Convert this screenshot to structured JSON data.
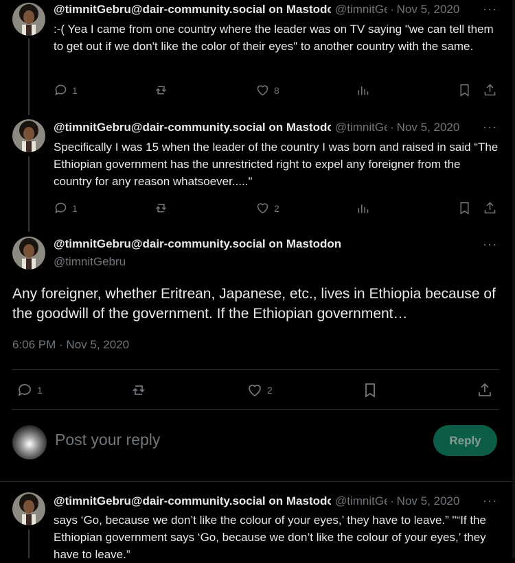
{
  "tweets_above": [
    {
      "name": "@timnitGebru@dair-community.social on Mastodon",
      "handle": "@timnitGebru",
      "date": "Nov 5, 2020",
      "text": ":-( Yea I came from one country where the leader was on TV saying \"we can tell them to get out if we don't like the color of their eyes\" to another country with the same.",
      "replies": "1",
      "likes": "8"
    },
    {
      "name": "@timnitGebru@dair-community.social on Mastodon",
      "handle": "@timnitGebru",
      "date": "Nov 5, 2020",
      "text": "Specifically I was 15 when the leader of the country I was born and raised in said “The Ethiopian government has the unrestricted right to expel any foreigner from the country for any reason whatsoever.....\"",
      "replies": "1",
      "likes": "2"
    }
  ],
  "main_tweet": {
    "name": "@timnitGebru@dair-community.social on Mastodon",
    "handle": "@timnitGebru",
    "text": "Any foreigner, whether Eritrean, Japanese, etc., lives in Ethiopia because of the goodwill of the government. If the Ethiopian government…",
    "time": "6:06 PM · Nov 5, 2020",
    "replies": "1",
    "likes": "2"
  },
  "reply_box": {
    "placeholder": "Post your reply",
    "button": "Reply"
  },
  "tweet_below": {
    "name": "@timnitGebru@dair-community.social on Mastodon",
    "handle": "@timnitGebru",
    "date": "Nov 5, 2020",
    "text": "says ‘Go, because we don’t like the colour of your eyes,’ they have to leave.” \"“If the Ethiopian government says ‘Go, because we don’t like the colour of your eyes,’ they have to leave.”"
  },
  "more_label": "···",
  "dot": "·",
  "colors": {
    "reply_button_bg": "#0b5d47",
    "muted": "#71767b",
    "divider": "#2f3336"
  }
}
